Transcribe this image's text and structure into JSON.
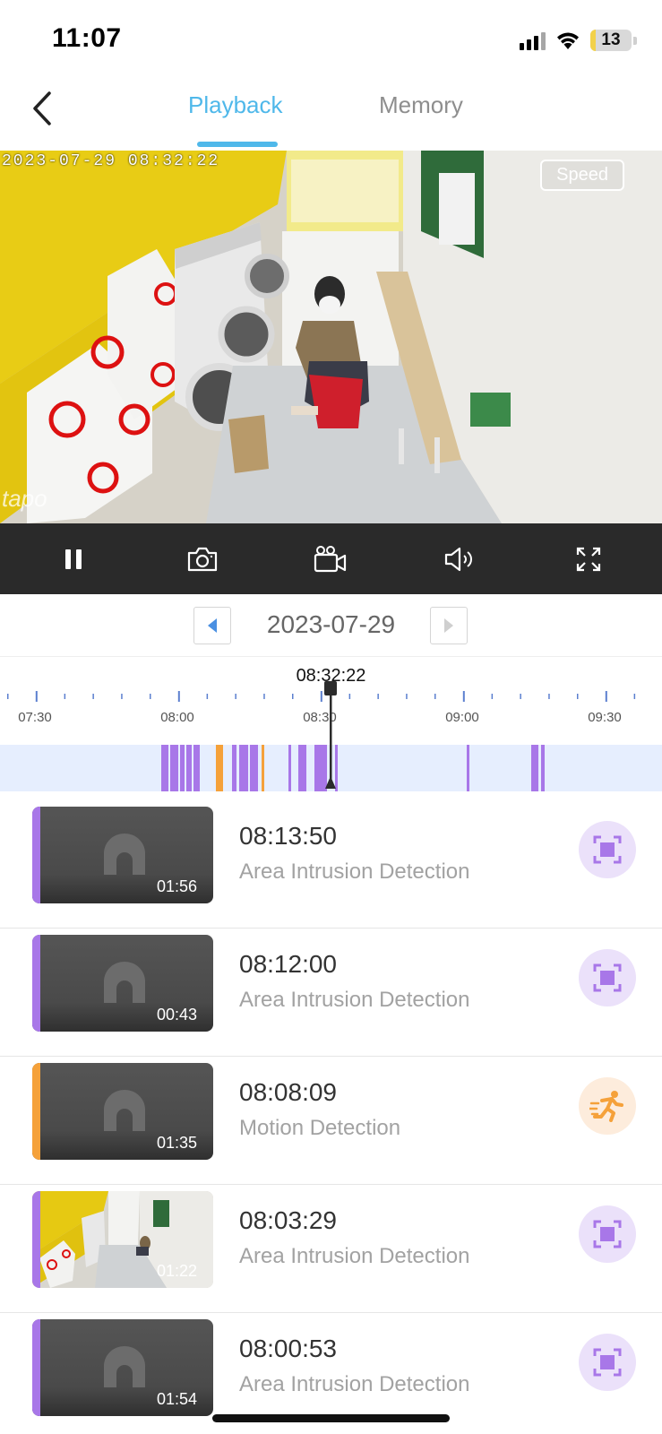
{
  "status_bar": {
    "time": "11:07",
    "battery": "13",
    "battery_level": 0.13
  },
  "header": {
    "back_icon": "chevron-left-icon",
    "tabs": [
      {
        "label": "Playback",
        "active": true
      },
      {
        "label": "Memory",
        "active": false
      }
    ],
    "accent_color": "#4fb8ea"
  },
  "video": {
    "timestamp": "2023-07-29  08:32:22",
    "speed_label": "Speed",
    "logo": "tapo"
  },
  "controls": [
    "pause-icon",
    "camera-icon",
    "video-record-icon",
    "volume-icon",
    "fullscreen-icon"
  ],
  "date": {
    "value": "2023-07-29",
    "prev_icon": "triangle-left-icon",
    "next_icon": "triangle-right-icon"
  },
  "timeline": {
    "current_time": "08:32:22",
    "labels": [
      "07:30",
      "08:00",
      "08:30",
      "09:00",
      "09:30"
    ],
    "colors": {
      "intrusion": "#a877e8",
      "motion": "#f5a13a",
      "strip": "#e6eefe"
    }
  },
  "events": [
    {
      "time": "08:13:50",
      "type": "Area Intrusion Detection",
      "duration": "01:56",
      "kind": "intrusion",
      "icon": "area-intrusion-icon"
    },
    {
      "time": "08:12:00",
      "type": "Area Intrusion Detection",
      "duration": "00:43",
      "kind": "intrusion",
      "icon": "area-intrusion-icon"
    },
    {
      "time": "08:08:09",
      "type": "Motion Detection",
      "duration": "01:35",
      "kind": "motion",
      "icon": "running-person-icon"
    },
    {
      "time": "08:03:29",
      "type": "Area Intrusion Detection",
      "duration": "01:22",
      "kind": "intrusion",
      "icon": "area-intrusion-icon",
      "has_image": true
    },
    {
      "time": "08:00:53",
      "type": "Area Intrusion Detection",
      "duration": "01:54",
      "kind": "intrusion",
      "icon": "area-intrusion-icon"
    }
  ]
}
